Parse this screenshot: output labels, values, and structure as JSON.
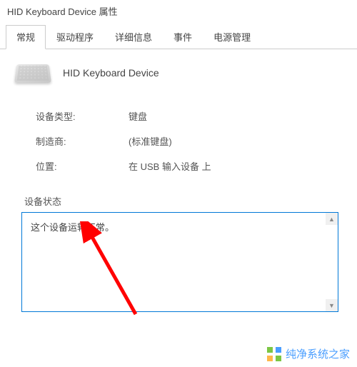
{
  "window": {
    "title": "HID Keyboard Device 属性"
  },
  "tabs": {
    "general": "常规",
    "driver": "驱动程序",
    "details": "详细信息",
    "events": "事件",
    "power": "电源管理"
  },
  "device": {
    "name": "HID Keyboard Device"
  },
  "info": {
    "type_label": "设备类型:",
    "type_value": "键盘",
    "manufacturer_label": "制造商:",
    "manufacturer_value": "(标准键盘)",
    "location_label": "位置:",
    "location_value": "在 USB 输入设备 上"
  },
  "status": {
    "label": "设备状态",
    "text": "这个设备运转正常。"
  },
  "watermark": {
    "text": "纯净系统之家"
  }
}
